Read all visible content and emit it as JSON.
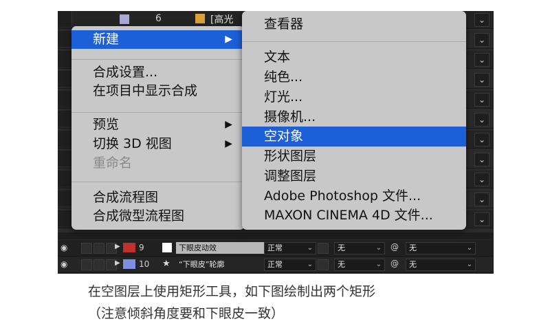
{
  "context_menu": {
    "items": [
      {
        "label": "新建",
        "arrow": "▶",
        "state": "selected"
      },
      {
        "label": "合成设置..."
      },
      {
        "label": "在项目中显示合成"
      },
      {
        "label": "预览",
        "arrow": "▶"
      },
      {
        "label": "切换 3D 视图",
        "arrow": "▶"
      },
      {
        "label": "重命名",
        "state": "disabled"
      },
      {
        "label": "合成流程图"
      },
      {
        "label": "合成微型流程图"
      }
    ]
  },
  "submenu": {
    "items": [
      {
        "label": "查看器"
      },
      {
        "label": "文本"
      },
      {
        "label": "纯色..."
      },
      {
        "label": "灯光..."
      },
      {
        "label": "摄像机..."
      },
      {
        "label": "空对象",
        "state": "selected"
      },
      {
        "label": "形状图层"
      },
      {
        "label": "调整图层"
      },
      {
        "label": "Adobe Photoshop 文件..."
      },
      {
        "label": "MAXON CINEMA 4D 文件..."
      }
    ]
  },
  "background": {
    "top_row_number": "6",
    "top_row_name_fragment": "[高光"
  },
  "layers": [
    {
      "number": "9",
      "color": "#c0302c",
      "name": "下眼皮动效",
      "mode": "正常",
      "trkmat": "无",
      "parent": "无"
    },
    {
      "number": "10",
      "color": "#7f8fe0",
      "star": "★",
      "name": "“下眼皮”轮廓",
      "mode": "正常",
      "trkmat": "无",
      "parent": "无"
    }
  ],
  "caption": {
    "line1": "在空图层上使用矩形工具，如下图绘制出两个矩形",
    "line2": "（注意倾斜角度要和下眼皮一致）"
  },
  "colors": {
    "menu_bg": "#c8c8c8",
    "highlight": "#1c5fd6",
    "panel_bg": "#2b2b2b"
  }
}
